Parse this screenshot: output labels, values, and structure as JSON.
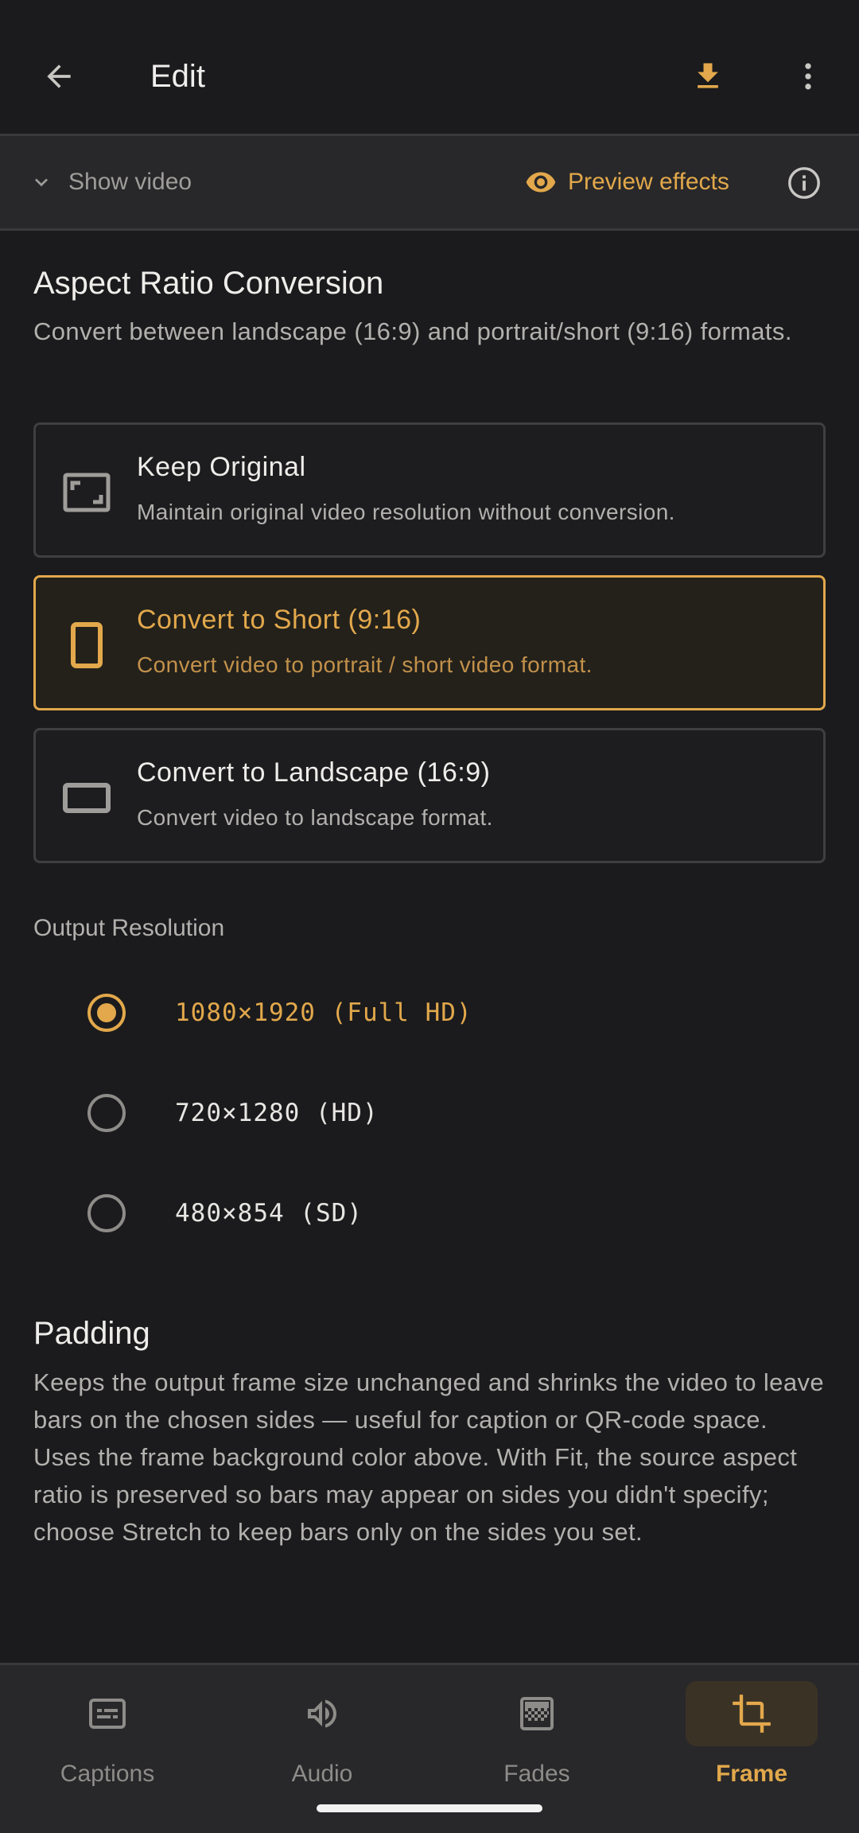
{
  "header": {
    "title": "Edit"
  },
  "subbar": {
    "show_video": "Show video",
    "preview_effects": "Preview effects"
  },
  "aspect": {
    "title": "Aspect Ratio Conversion",
    "description": "Convert between landscape (16:9) and portrait/short (9:16) formats.",
    "options": [
      {
        "title": "Keep Original",
        "subtitle": "Maintain original video resolution without conversion.",
        "icon": "aspect-ratio-icon",
        "selected": false
      },
      {
        "title": "Convert to Short (9:16)",
        "subtitle": "Convert video to portrait / short video format.",
        "icon": "phone-portrait-icon",
        "selected": true
      },
      {
        "title": "Convert to Landscape (16:9)",
        "subtitle": "Convert video to landscape format.",
        "icon": "landscape-icon",
        "selected": false
      }
    ]
  },
  "resolution": {
    "label": "Output Resolution",
    "options": [
      {
        "label": "1080×1920 (Full HD)",
        "selected": true
      },
      {
        "label": "720×1280 (HD)",
        "selected": false
      },
      {
        "label": "480×854 (SD)",
        "selected": false
      }
    ]
  },
  "padding": {
    "title": "Padding",
    "description": "Keeps the output frame size unchanged and shrinks the video to leave bars on the chosen sides — useful for caption or QR-code space. Uses the frame background color above. With Fit, the source aspect ratio is preserved so bars may appear on sides you didn't specify; choose Stretch to keep bars only on the sides you set."
  },
  "nav": [
    {
      "label": "Captions",
      "icon": "captions-icon",
      "active": false
    },
    {
      "label": "Audio",
      "icon": "volume-icon",
      "active": false
    },
    {
      "label": "Fades",
      "icon": "gradient-icon",
      "active": false
    },
    {
      "label": "Frame",
      "icon": "crop-icon",
      "active": true
    }
  ],
  "colors": {
    "accent": "#e2a84b",
    "background": "#1b1b1d",
    "surface": "#28282a"
  }
}
